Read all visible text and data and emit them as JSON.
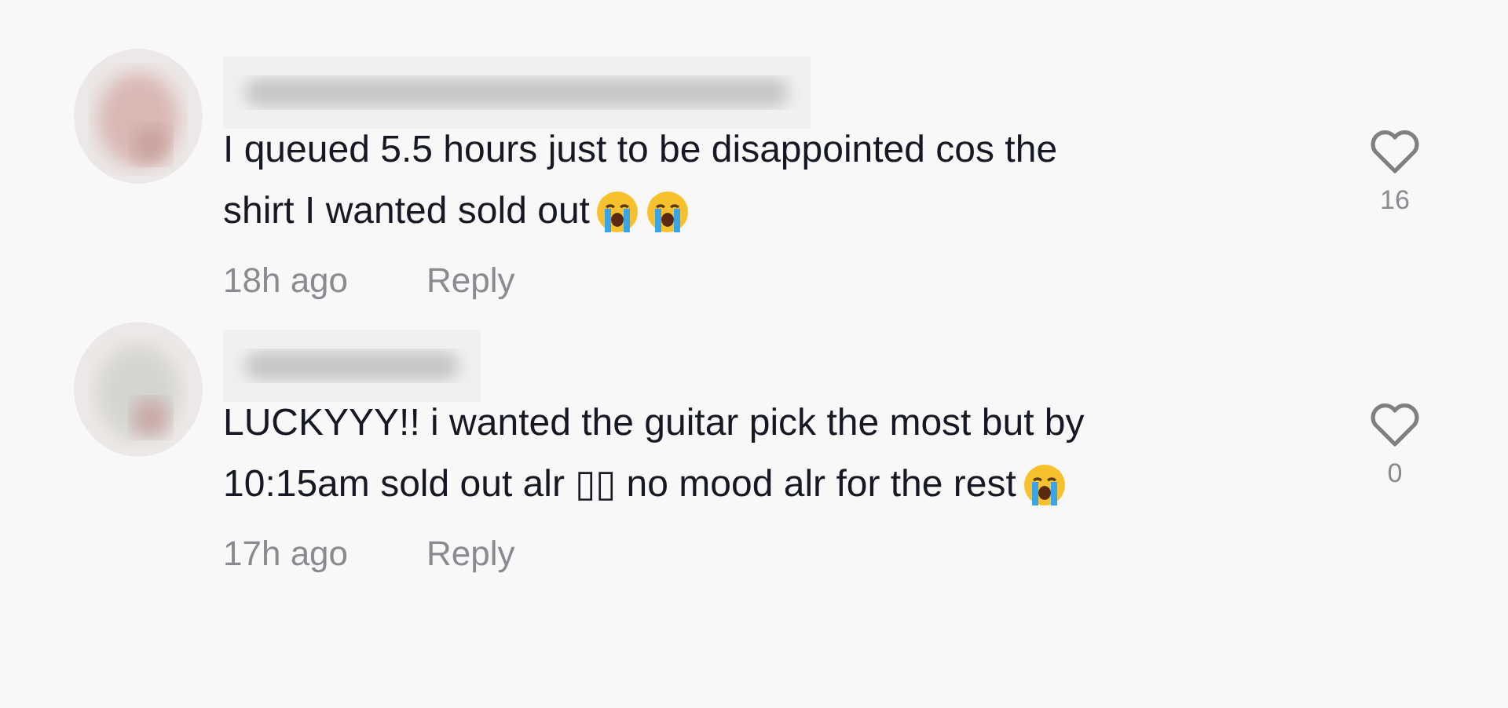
{
  "comments": [
    {
      "lines": [
        [
          {
            "kind": "text",
            "text": "I queued 5.5 hours just to be disappointed cos the"
          }
        ],
        [
          {
            "kind": "text",
            "text": "shirt I wanted sold out"
          },
          {
            "kind": "emoji"
          },
          {
            "kind": "emoji"
          }
        ]
      ],
      "time": "18h ago",
      "reply": "Reply",
      "liked": false,
      "likes": "16"
    },
    {
      "lines": [
        [
          {
            "kind": "text",
            "text": "LUCKYYY!! i wanted the guitar pick the most but by"
          }
        ],
        [
          {
            "kind": "text",
            "text": "10:15am sold out alr ▯▯ no mood alr for the rest"
          },
          {
            "kind": "emoji"
          }
        ]
      ],
      "time": "17h ago",
      "reply": "Reply",
      "liked": false,
      "likes": "0"
    }
  ]
}
